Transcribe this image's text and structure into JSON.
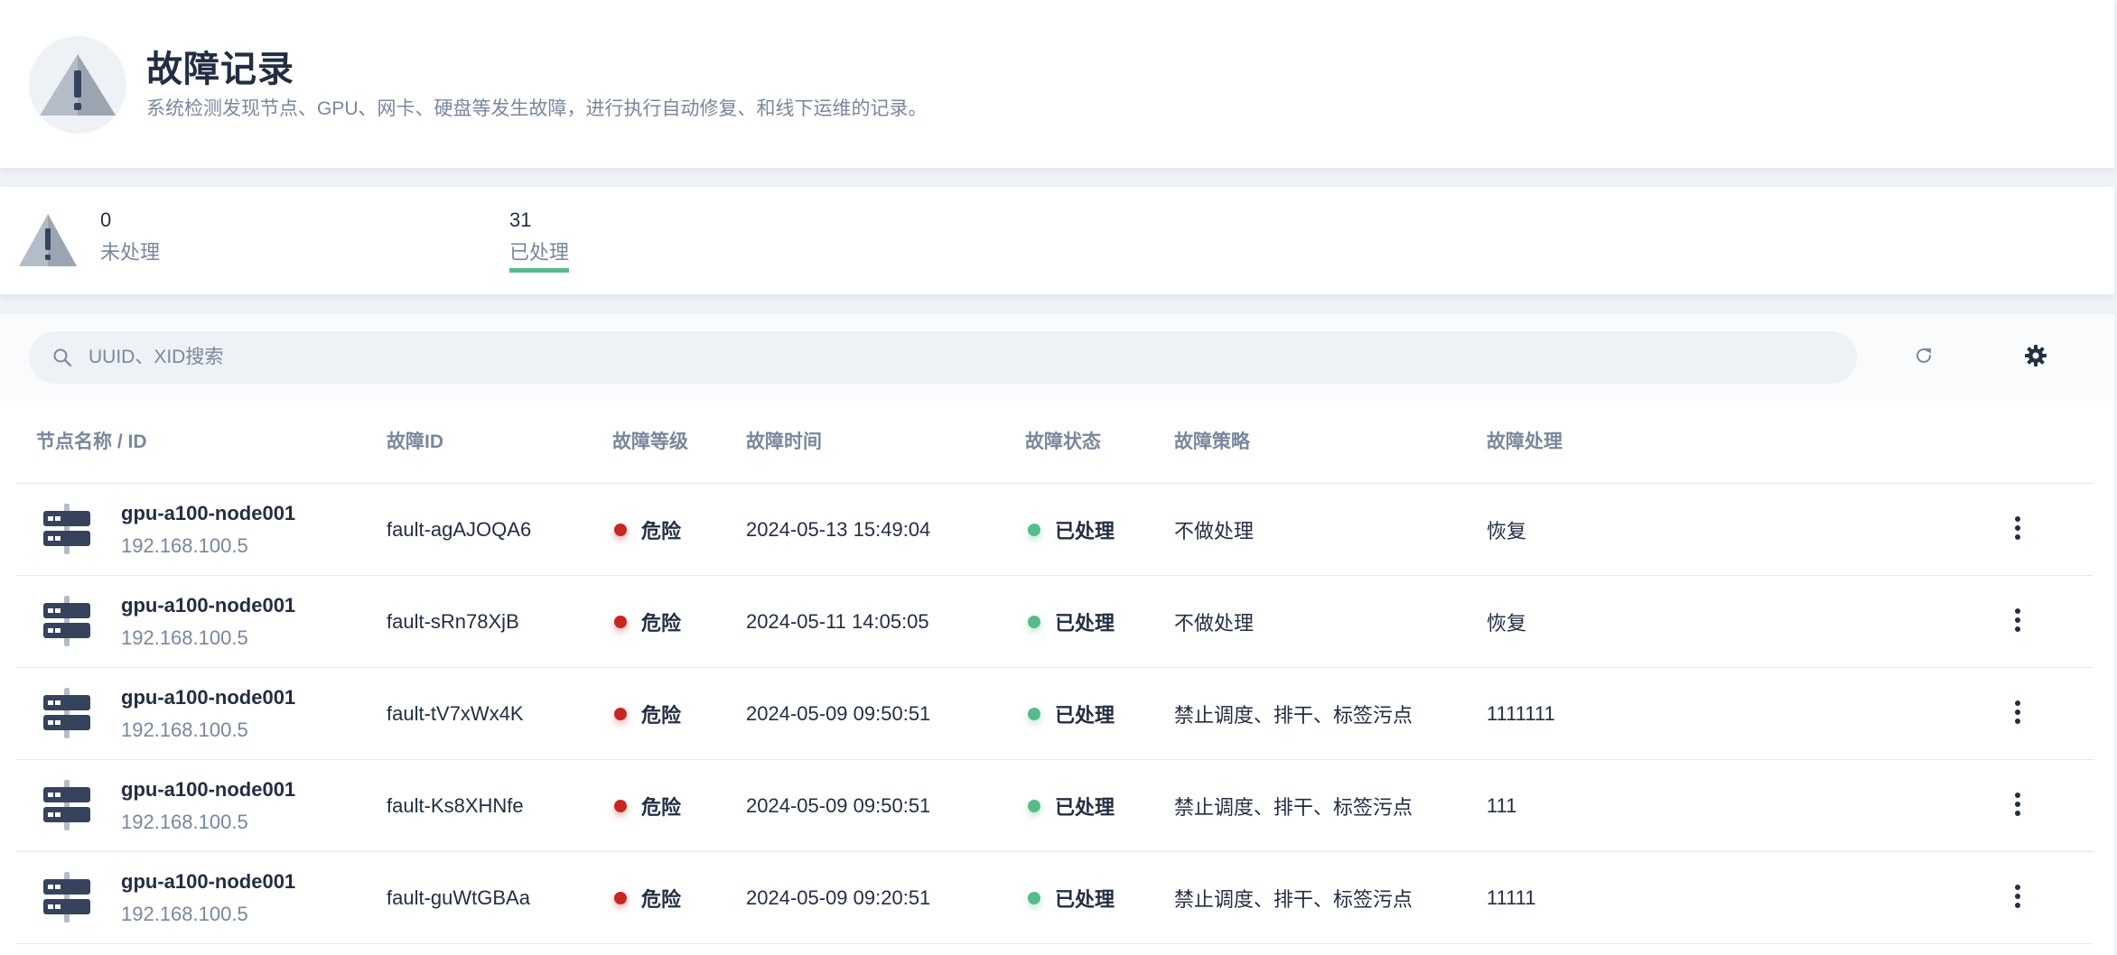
{
  "header": {
    "title": "故障记录",
    "description": "系统检测发现节点、GPU、网卡、硬盘等发生故障，进行执行自动修复、和线下运维的记录。",
    "icon": "warning-icon"
  },
  "stats": {
    "icon": "warning-icon",
    "items": [
      {
        "value": "0",
        "label": "未处理",
        "active": false
      },
      {
        "value": "31",
        "label": "已处理",
        "active": true
      }
    ],
    "active_color": "#55bc8a"
  },
  "toolbar": {
    "search_placeholder": "UUID、XID搜索",
    "search_value": "",
    "refresh_icon": "refresh-icon",
    "settings_icon": "gear-icon"
  },
  "table": {
    "columns": [
      "节点名称 / ID",
      "故障ID",
      "故障等级",
      "故障时间",
      "故障状态",
      "故障策略",
      "故障处理"
    ],
    "rows": [
      {
        "node_name": "gpu-a100-node001",
        "node_ip": "192.168.100.5",
        "fault_id": "fault-agAJOQA6",
        "level": "危险",
        "time": "2024-05-13 15:49:04",
        "status": "已处理",
        "policy": "不做处理",
        "handling": "恢复"
      },
      {
        "node_name": "gpu-a100-node001",
        "node_ip": "192.168.100.5",
        "fault_id": "fault-sRn78XjB",
        "level": "危险",
        "time": "2024-05-11 14:05:05",
        "status": "已处理",
        "policy": "不做处理",
        "handling": "恢复"
      },
      {
        "node_name": "gpu-a100-node001",
        "node_ip": "192.168.100.5",
        "fault_id": "fault-tV7xWx4K",
        "level": "危险",
        "time": "2024-05-09 09:50:51",
        "status": "已处理",
        "policy": "禁止调度、排干、标签污点",
        "handling": "1111111"
      },
      {
        "node_name": "gpu-a100-node001",
        "node_ip": "192.168.100.5",
        "fault_id": "fault-Ks8XHNfe",
        "level": "危险",
        "time": "2024-05-09 09:50:51",
        "status": "已处理",
        "policy": "禁止调度、排干、标签污点",
        "handling": "111"
      },
      {
        "node_name": "gpu-a100-node001",
        "node_ip": "192.168.100.5",
        "fault_id": "fault-guWtGBAa",
        "level": "危险",
        "time": "2024-05-09 09:20:51",
        "status": "已处理",
        "policy": "禁止调度、排干、标签污点",
        "handling": "11111"
      }
    ],
    "level_color": "#ca2621",
    "status_color": "#55bc8a"
  }
}
